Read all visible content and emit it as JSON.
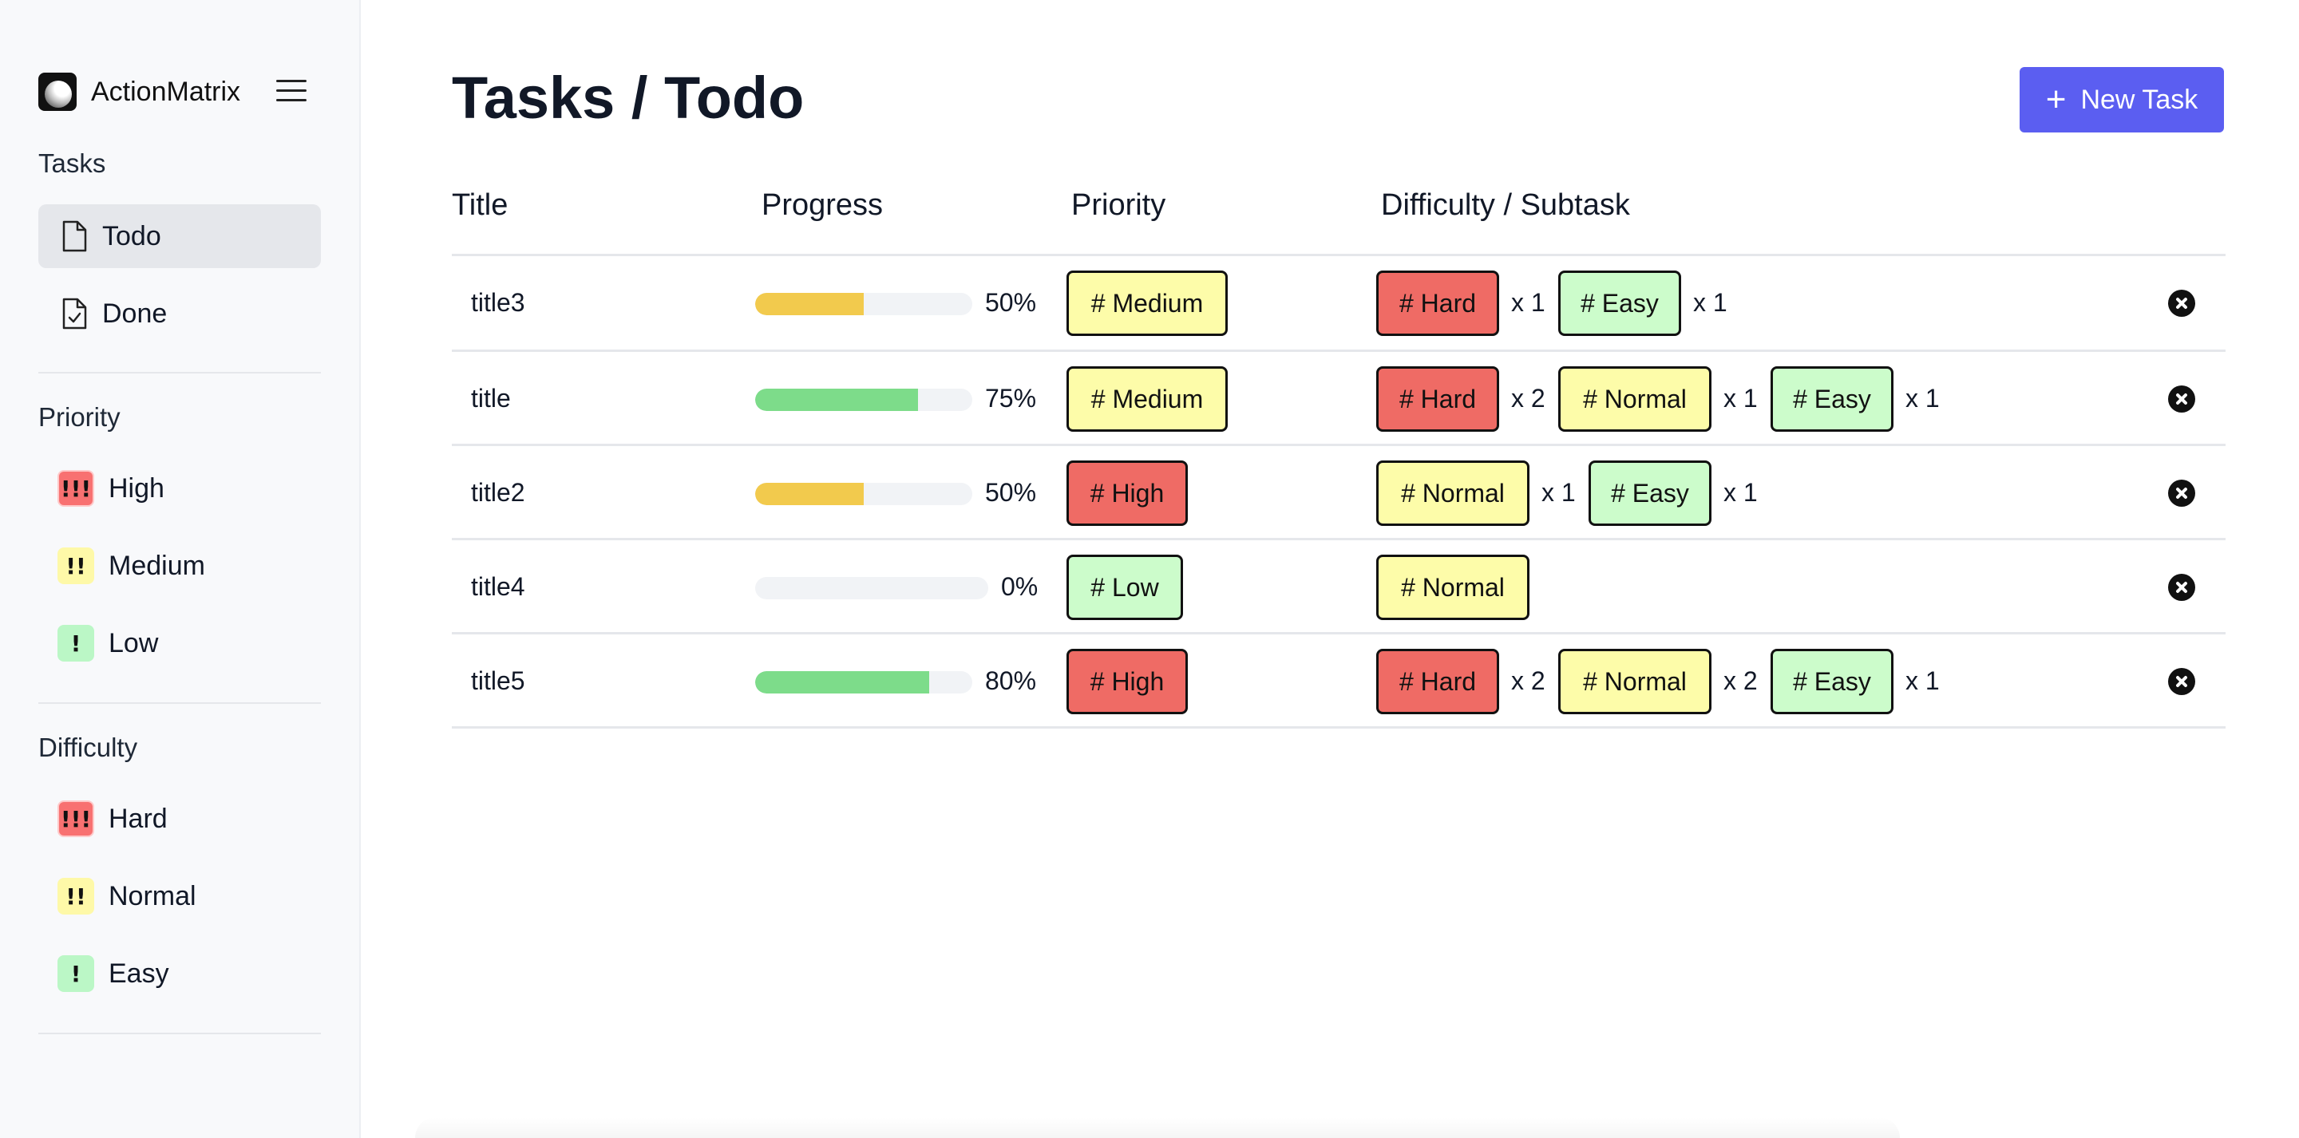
{
  "app": {
    "name": "ActionMatrix"
  },
  "sidebar": {
    "tasks_title": "Tasks",
    "tasks_items": [
      {
        "label": "Todo",
        "icon": "file-icon",
        "active": true
      },
      {
        "label": "Done",
        "icon": "file-check-icon",
        "active": false
      }
    ],
    "priority_title": "Priority",
    "priority_items": [
      {
        "label": "High",
        "icon": "!!!",
        "color": "#f87171"
      },
      {
        "label": "Medium",
        "icon": "!!",
        "color": "#fef9a8"
      },
      {
        "label": "Low",
        "icon": "!",
        "color": "#bbf7c6"
      }
    ],
    "difficulty_title": "Difficulty",
    "difficulty_items": [
      {
        "label": "Hard",
        "icon": "!!!",
        "color": "#f87171"
      },
      {
        "label": "Normal",
        "icon": "!!",
        "color": "#fef9a8"
      },
      {
        "label": "Easy",
        "icon": "!",
        "color": "#bbf7c6"
      }
    ]
  },
  "header": {
    "title": "Tasks / Todo",
    "new_task_label": "New Task",
    "accent": "#5b5ef1"
  },
  "table": {
    "columns": [
      "Title",
      "Progress",
      "Priority",
      "Difficulty / Subtask"
    ],
    "rows": [
      {
        "title": "title3",
        "progress": 50,
        "progress_label": "50%",
        "priority": "# Medium",
        "subtasks": [
          {
            "tag": "# Hard",
            "count": "x 1"
          },
          {
            "tag": "# Easy",
            "count": "x 1"
          }
        ]
      },
      {
        "title": "title",
        "progress": 75,
        "progress_label": "75%",
        "priority": "# Medium",
        "subtasks": [
          {
            "tag": "# Hard",
            "count": "x 2"
          },
          {
            "tag": "# Normal",
            "count": "x 1"
          },
          {
            "tag": "# Easy",
            "count": "x 1"
          }
        ]
      },
      {
        "title": "title2",
        "progress": 50,
        "progress_label": "50%",
        "priority": "# High",
        "subtasks": [
          {
            "tag": "# Normal",
            "count": "x 1"
          },
          {
            "tag": "# Easy",
            "count": "x 1"
          }
        ]
      },
      {
        "title": "title4",
        "progress": 0,
        "progress_label": "0%",
        "priority": "# Low",
        "subtasks": [
          {
            "tag": "# Normal",
            "count": ""
          }
        ]
      },
      {
        "title": "title5",
        "progress": 80,
        "progress_label": "80%",
        "priority": "# High",
        "subtasks": [
          {
            "tag": "# Hard",
            "count": "x 2"
          },
          {
            "tag": "# Normal",
            "count": "x 2"
          },
          {
            "tag": "# Easy",
            "count": "x 1"
          }
        ]
      }
    ],
    "colors": {
      "progress_mid": "#f2ca4d",
      "progress_high": "#7ddc8a",
      "hard": "#ef6b65",
      "normal": "#fdfca9",
      "easy": "#ccfccb"
    }
  }
}
